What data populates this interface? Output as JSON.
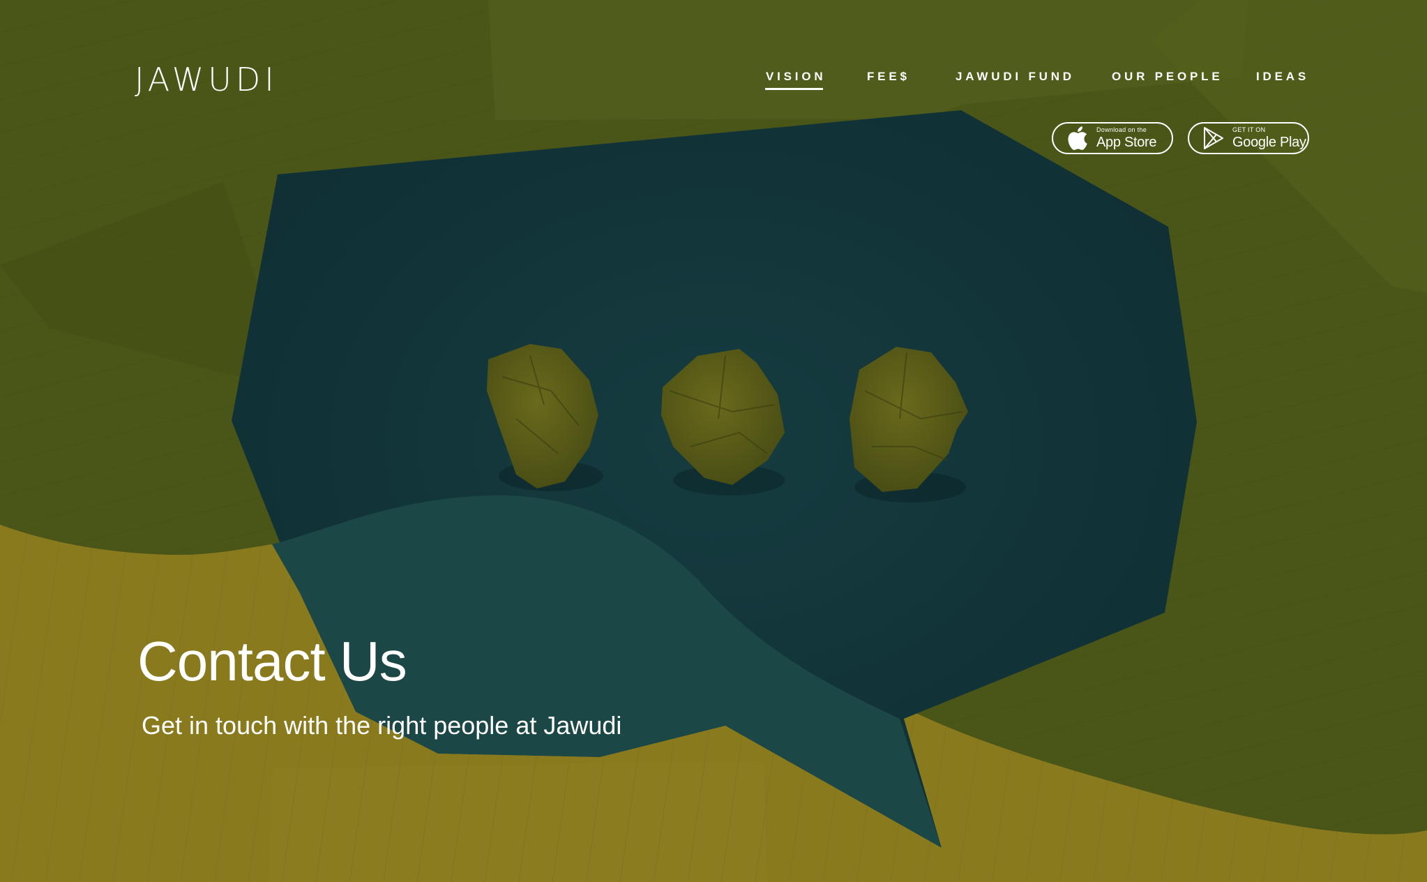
{
  "brand": {
    "logo_text": "JAWUDI"
  },
  "nav": {
    "items": [
      {
        "label": "VISION",
        "active": true
      },
      {
        "label": "FEE$",
        "active": false
      },
      {
        "label": "JAWUDI FUND",
        "active": false
      },
      {
        "label": "OUR PEOPLE",
        "active": false
      },
      {
        "label": "IDEAS",
        "active": false
      }
    ]
  },
  "app_badges": {
    "app_store": {
      "small_text": "Download on the",
      "big_text": "App Store",
      "icon": "apple-icon"
    },
    "google_play": {
      "small_text": "GET IT ON",
      "big_text": "Google Play",
      "icon": "google-play-icon"
    }
  },
  "hero": {
    "title": "Contact Us",
    "subtitle": "Get in touch with the right people at Jawudi"
  },
  "colors": {
    "olive": "#4a5518",
    "mustard": "#8a7a1e",
    "teal_dark": "#11333a",
    "teal_light": "#1c4a48",
    "text": "#ffffff"
  }
}
